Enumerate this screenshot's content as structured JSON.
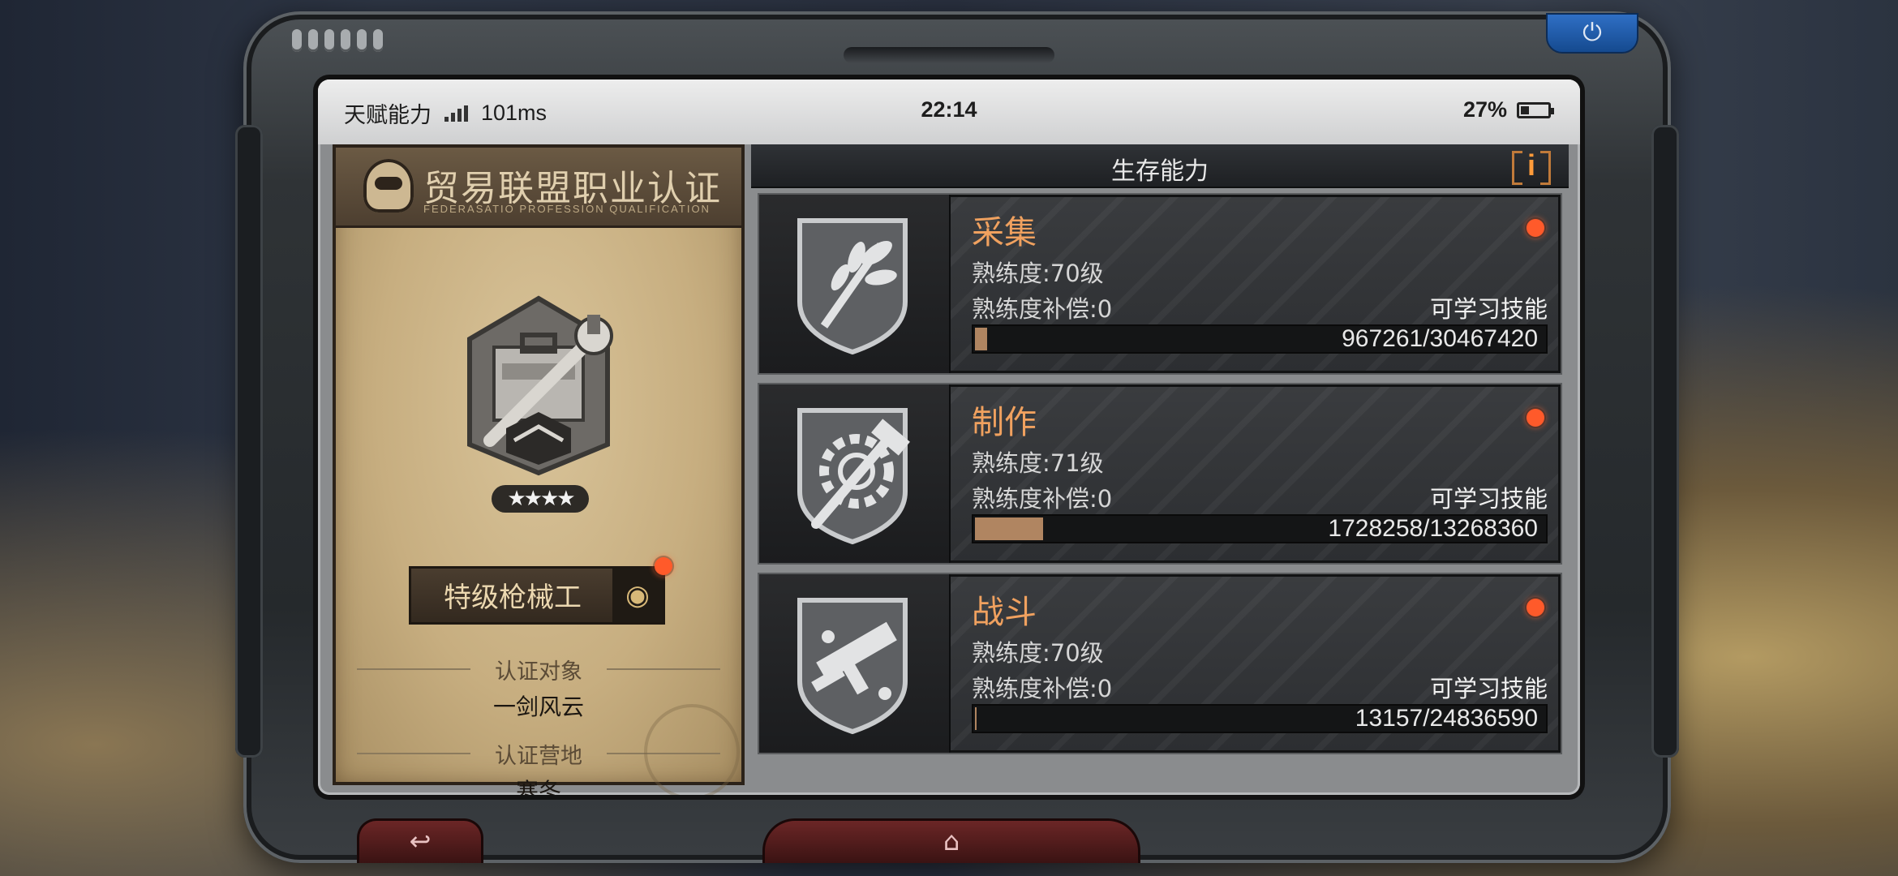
{
  "status_bar": {
    "app_label": "天赋能力",
    "ping": "101ms",
    "time": "22:14",
    "battery": "27%"
  },
  "certificate": {
    "title": "贸易联盟职业认证",
    "subtitle": "FEDERASATIO PROFESSION QUALIFICATION",
    "stars": "★★★★",
    "rank": "特级枪械工",
    "target_label": "认证对象",
    "target_value": "一剑风云",
    "camp_label": "认证营地",
    "camp_value": "寒冬"
  },
  "panel": {
    "title": "生存能力",
    "info": "i"
  },
  "skills": [
    {
      "name": "采集",
      "level": "熟练度:70级",
      "compensation": "熟练度补偿:0",
      "learnable": "可学习技能",
      "progress_text": "967261/30467420",
      "progress_fraction": 0.032,
      "icon": "herb-shield-icon"
    },
    {
      "name": "制作",
      "level": "熟练度:71级",
      "compensation": "熟练度补偿:0",
      "learnable": "可学习技能",
      "progress_text": "1728258/13268360",
      "progress_fraction": 0.13,
      "icon": "gear-hammer-shield-icon"
    },
    {
      "name": "战斗",
      "level": "熟练度:70级",
      "compensation": "熟练度补偿:0",
      "learnable": "可学习技能",
      "progress_text": "13157/24836590",
      "progress_fraction": 0.0005,
      "icon": "gun-shield-icon"
    }
  ],
  "nav": {
    "back_icon": "back-arrow-icon",
    "home_icon": "home-icon"
  },
  "colors": {
    "accent": "#f0a15f",
    "progress": "#b08561",
    "notification": "#ff5a2a",
    "power_button": "#2f6fc5"
  }
}
